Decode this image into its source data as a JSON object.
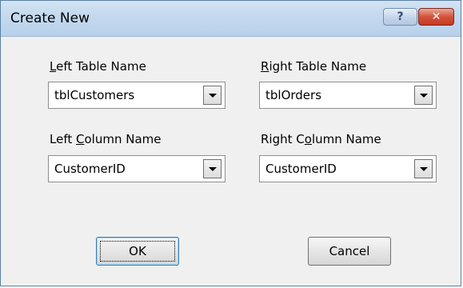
{
  "window": {
    "title": "Create New",
    "help_glyph": "?",
    "close_glyph": "✕"
  },
  "left_table": {
    "label_prefix": "",
    "label_accel": "L",
    "label_rest": "eft Table Name",
    "value": "tblCustomers"
  },
  "right_table": {
    "label_prefix": "",
    "label_accel": "R",
    "label_rest": "ight Table Name",
    "value": "tblOrders"
  },
  "left_column": {
    "label_prefix": "Left ",
    "label_accel": "C",
    "label_rest": "olumn Name",
    "value": "CustomerID"
  },
  "right_column": {
    "label_prefix": "Right C",
    "label_accel": "o",
    "label_rest": "lumn Name",
    "value": "CustomerID"
  },
  "buttons": {
    "ok_label": "OK",
    "cancel_label": "Cancel"
  }
}
